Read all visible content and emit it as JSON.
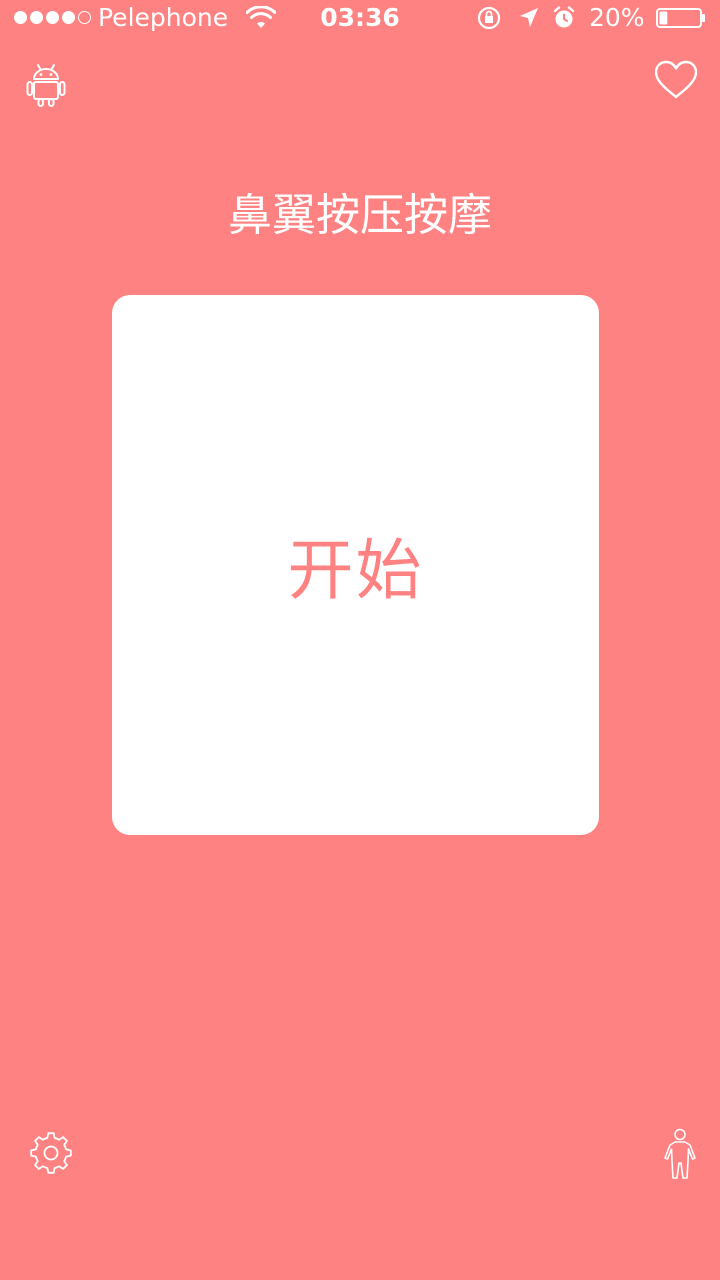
{
  "status_bar": {
    "signal_dots_filled": 4,
    "signal_dots_total": 5,
    "carrier": "Pelephone",
    "time": "03:36",
    "battery_percent": "20%",
    "battery_level": 0.2,
    "icons": [
      "wifi-icon",
      "rotation-lock-icon",
      "location-arrow-icon",
      "alarm-icon",
      "battery-icon"
    ]
  },
  "header": {
    "left_icon": "android-icon",
    "right_icon": "heart-icon"
  },
  "title": "鼻翼按压按摩",
  "start_button": {
    "label": "开始"
  },
  "footer": {
    "left_icon": "gear-icon",
    "right_icon": "person-icon"
  },
  "colors": {
    "background": "#FF8282",
    "card": "#FFFFFF",
    "accent_text": "#FF8282",
    "foreground": "#FFFFFF"
  }
}
